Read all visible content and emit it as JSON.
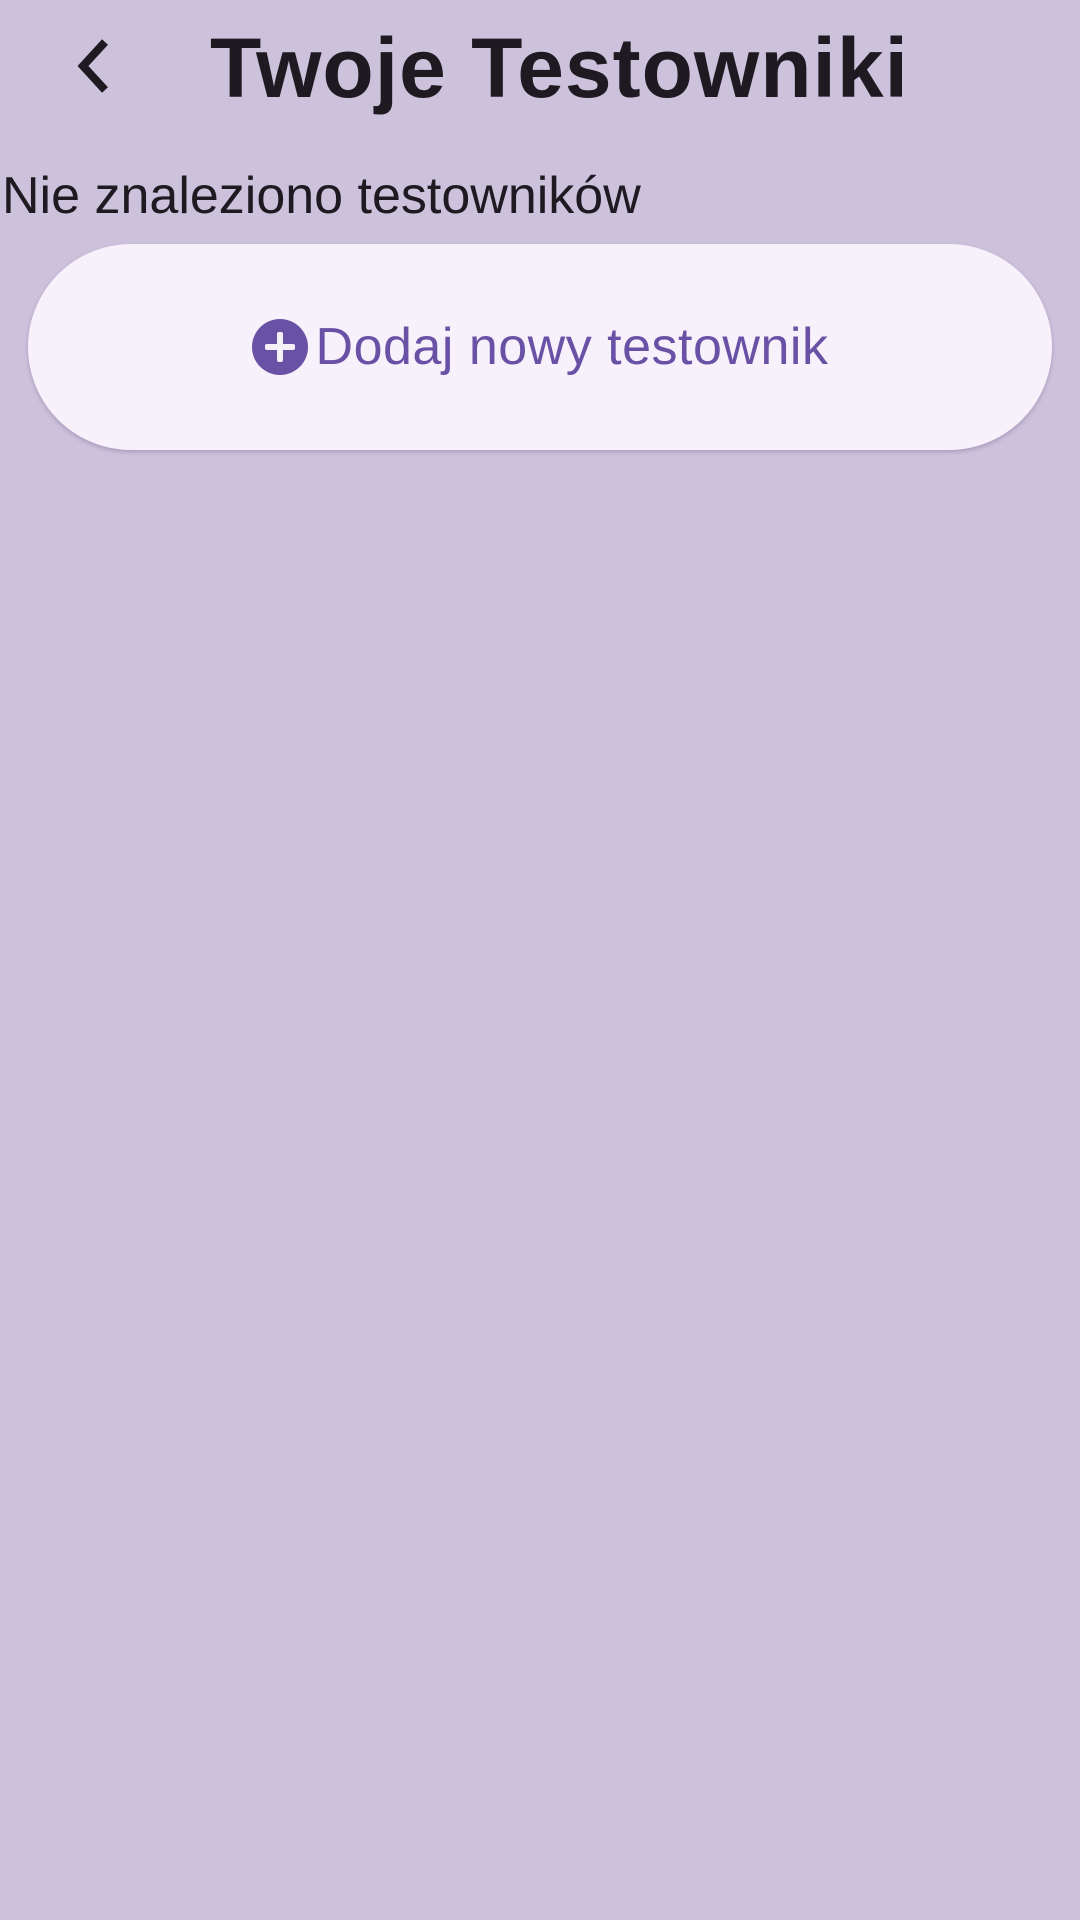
{
  "header": {
    "back_icon": "chevron-left-icon",
    "title": "Twoje Testowniki"
  },
  "main": {
    "empty_message": "Nie znaleziono testowników",
    "add_button": {
      "icon": "add-circle-icon",
      "label": "Dodaj nowy testownik"
    }
  },
  "colors": {
    "background": "#cdc2dc",
    "button_background": "#f7f1fb",
    "accent": "#6952a6",
    "text": "#1d1a22"
  }
}
